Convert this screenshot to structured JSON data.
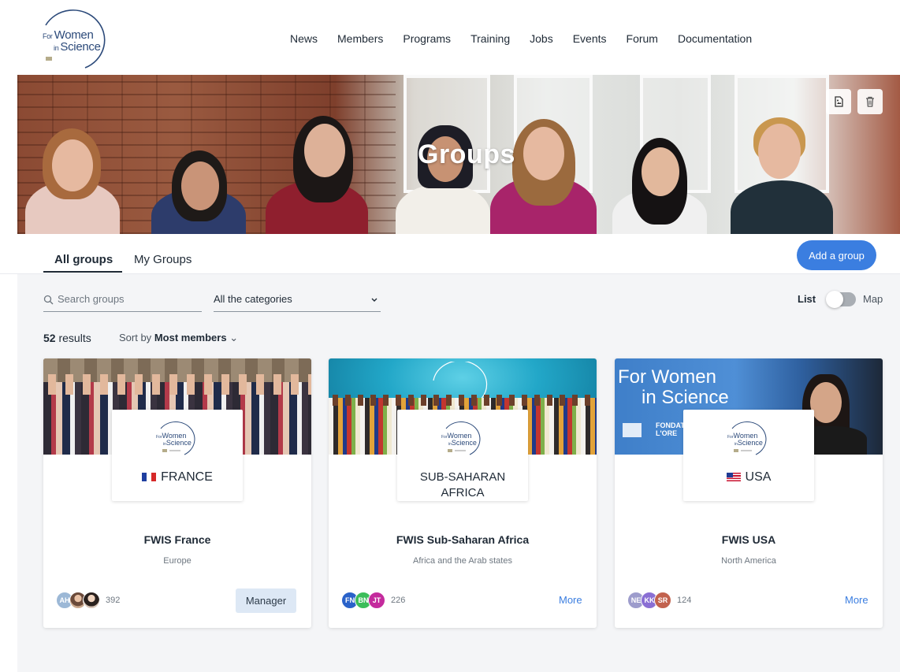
{
  "brand": {
    "logo_line1_small": "For",
    "logo_line1": "Women",
    "logo_line2_small": "in",
    "logo_line2": "Science"
  },
  "nav": {
    "items": [
      "News",
      "Members",
      "Programs",
      "Training",
      "Jobs",
      "Events",
      "Forum",
      "Documentation"
    ]
  },
  "banner": {
    "title": "Groups"
  },
  "tabs": {
    "items": [
      {
        "label": "All groups",
        "active": true
      },
      {
        "label": "My Groups",
        "active": false
      }
    ],
    "add_button": "Add a group"
  },
  "filters": {
    "search_placeholder": "Search groups",
    "category_value": "All the categories",
    "view_list": "List",
    "view_map": "Map",
    "view_mode": "list"
  },
  "results": {
    "count": "52",
    "label": "results",
    "sort_prefix": "Sort by",
    "sort_value": "Most members"
  },
  "colors": {
    "accent": "#3b7ee0",
    "manager_button_bg": "#dde8f5",
    "background": "#f4f5f7"
  },
  "groups": [
    {
      "badge_text": "FRANCE",
      "flag": "france-flag-icon",
      "title": "FWIS France",
      "region": "Europe",
      "member_count": "392",
      "avatars": [
        "AH",
        "photo",
        "photo"
      ],
      "action": "Manager"
    },
    {
      "badge_text": "SUB-SAHARAN AFRICA",
      "badge_line1": "SUB-SAHARAN",
      "badge_line2": "AFRICA",
      "flag": "",
      "title": "FWIS Sub-Saharan Africa",
      "region": "Africa and the Arab states",
      "member_count": "226",
      "avatars": [
        "FN",
        "BN",
        "JT"
      ],
      "action": "More"
    },
    {
      "badge_text": "USA",
      "flag": "usa-flag-icon",
      "title": "FWIS USA",
      "region": "North America",
      "member_count": "124",
      "avatars": [
        "NE",
        "KK",
        "SR"
      ],
      "action": "More",
      "image_text_line1": "For Women",
      "image_text_line2": "in Science",
      "image_text_line3": "FONDAT",
      "image_text_line4": "L'ORE"
    }
  ]
}
